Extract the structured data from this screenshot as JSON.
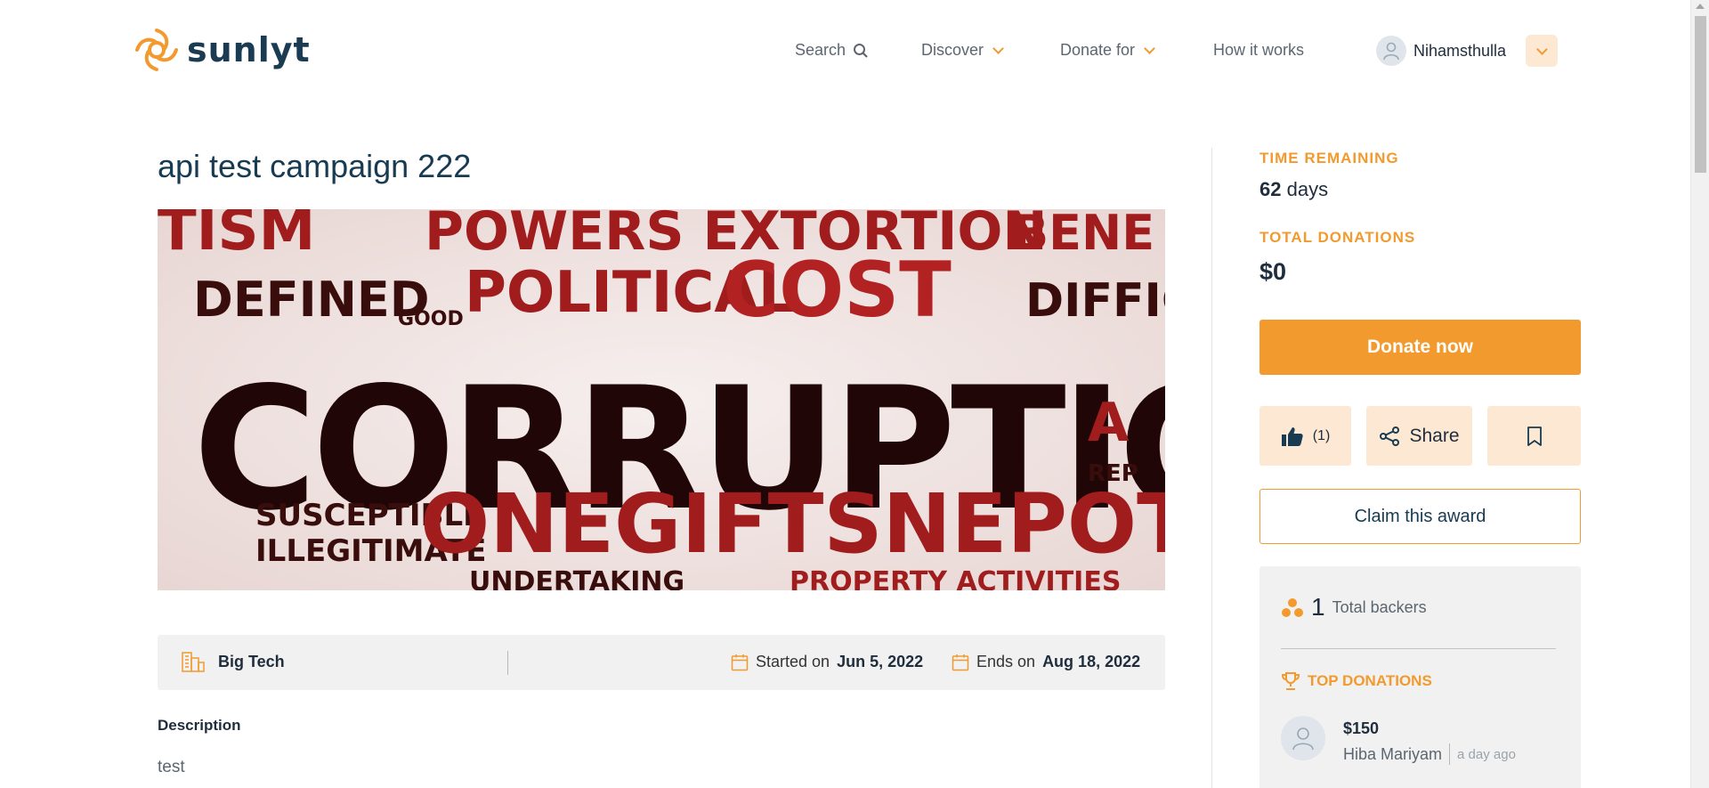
{
  "brand": {
    "name": "sunlyt",
    "accent": "#f29a2e",
    "navy": "#173b52"
  },
  "nav": {
    "search": "Search",
    "discover": "Discover",
    "donate_for": "Donate for",
    "how_it_works": "How it works",
    "user_name": "Nihamsthulla"
  },
  "campaign": {
    "title": "api test campaign 222",
    "hero_icon": "corruption-word-cloud-image",
    "category": "Big Tech",
    "started_label": "Started on",
    "started_date": "Jun 5, 2022",
    "ends_label": "Ends on",
    "ends_date": "Aug 18, 2022",
    "description_label": "Description",
    "description": "test"
  },
  "sidebar": {
    "time_label": "TIME REMAINING",
    "time_number": "62",
    "time_unit": " days",
    "donations_label": "TOTAL DONATIONS",
    "donations_value": "$0",
    "donate_button": "Donate now",
    "like_count": "(1)",
    "share_label": "Share",
    "claim_button": "Claim this award",
    "backers_count": "1",
    "backers_label": "Total backers",
    "top_donations_label": "TOP DONATIONS",
    "donors": [
      {
        "amount": "$150",
        "name": "Hiba Mariyam",
        "time": "a day ago"
      }
    ]
  }
}
